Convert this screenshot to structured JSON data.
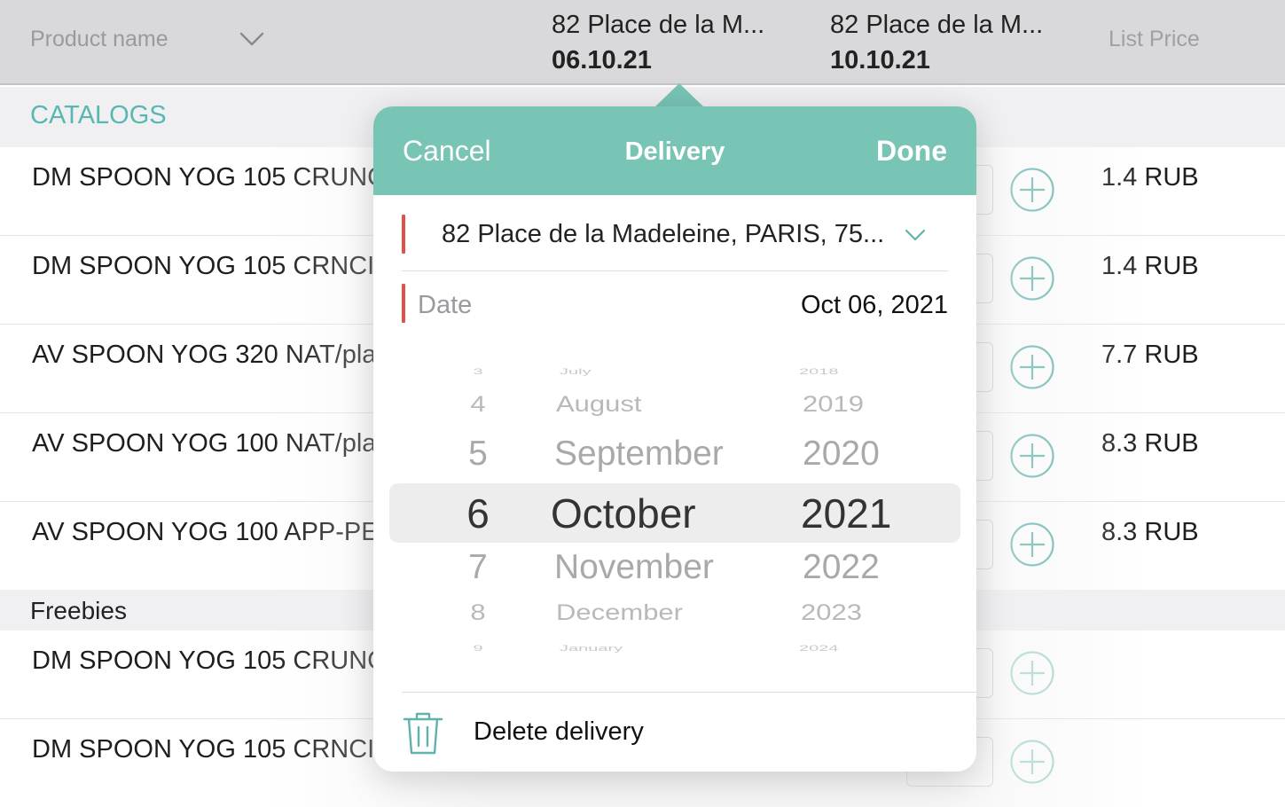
{
  "header": {
    "product_name_label": "Product name",
    "columns": [
      {
        "address": "82 Place de la M...",
        "date": "06.10.21"
      },
      {
        "address": "82 Place de la M...",
        "date": "10.10.21"
      }
    ],
    "list_price_label": "List Price"
  },
  "sections": {
    "catalogs": "CATALOGS",
    "freebies": "Freebies"
  },
  "rows": [
    {
      "name": "DM SPOON YOG 105 CRUNC",
      "price": "1.4 RUB"
    },
    {
      "name": "DM SPOON YOG 105 CRNCI",
      "price": "1.4 RUB"
    },
    {
      "name": "AV SPOON YOG 320 NAT/pla",
      "price": "7.7 RUB"
    },
    {
      "name": "AV SPOON YOG 100 NAT/pla",
      "price": "8.3 RUB"
    },
    {
      "name": "AV SPOON YOG 100 APP-PE",
      "price": "8.3 RUB"
    }
  ],
  "freebie_rows": [
    {
      "name": "DM SPOON YOG 105 CRUNC"
    },
    {
      "name": "DM SPOON YOG 105 CRNCI"
    }
  ],
  "popover": {
    "cancel_label": "Cancel",
    "title": "Delivery",
    "done_label": "Done",
    "address": "82 Place de la Madeleine, PARIS, 75...",
    "date_label": "Date",
    "date_value": "Oct 06, 2021",
    "picker": {
      "days": [
        "3",
        "4",
        "5",
        "6",
        "7",
        "8",
        "9"
      ],
      "months": [
        "July",
        "August",
        "September",
        "October",
        "November",
        "December",
        "January"
      ],
      "years": [
        "2018",
        "2019",
        "2020",
        "2021",
        "2022",
        "2023",
        "2024"
      ],
      "selected_day": "6",
      "selected_month": "October",
      "selected_year": "2021"
    },
    "delete_label": "Delete delivery"
  },
  "colors": {
    "accent": "#78c4b5",
    "section_accent": "#58b8b1",
    "required_marker": "#e0524b"
  }
}
